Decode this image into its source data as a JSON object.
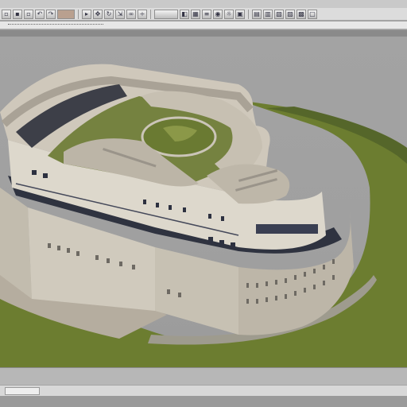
{
  "toolbar": {
    "groups": [
      {
        "buttons": [
          "file-icon",
          "folder-icon",
          "save-icon",
          "undo-icon",
          "redo-icon",
          "image-icon"
        ]
      },
      {
        "buttons": [
          "select-icon",
          "move-icon",
          "rotate-icon",
          "scale-icon",
          "link-icon",
          "unlink-icon"
        ]
      },
      {
        "buttons": [
          "render-icon",
          "material-icon",
          "grid-icon",
          "layer-icon",
          "camera-icon",
          "light-icon",
          "view-icon"
        ]
      }
    ]
  },
  "ribbon": {
    "crumb": "",
    "path": ""
  },
  "viewport": {
    "label": "",
    "colors": {
      "background": "#a2a2a2",
      "building": "#d7d2c6",
      "building_shadow": "#9d978b",
      "roof_ring": "#cdc6ba",
      "garden": "#6f7c37",
      "lawn": "#697c2e",
      "road": "#3a3d45",
      "windows": "#2d3140",
      "ground": "#b9b2a5"
    }
  },
  "status": {
    "text": ""
  }
}
